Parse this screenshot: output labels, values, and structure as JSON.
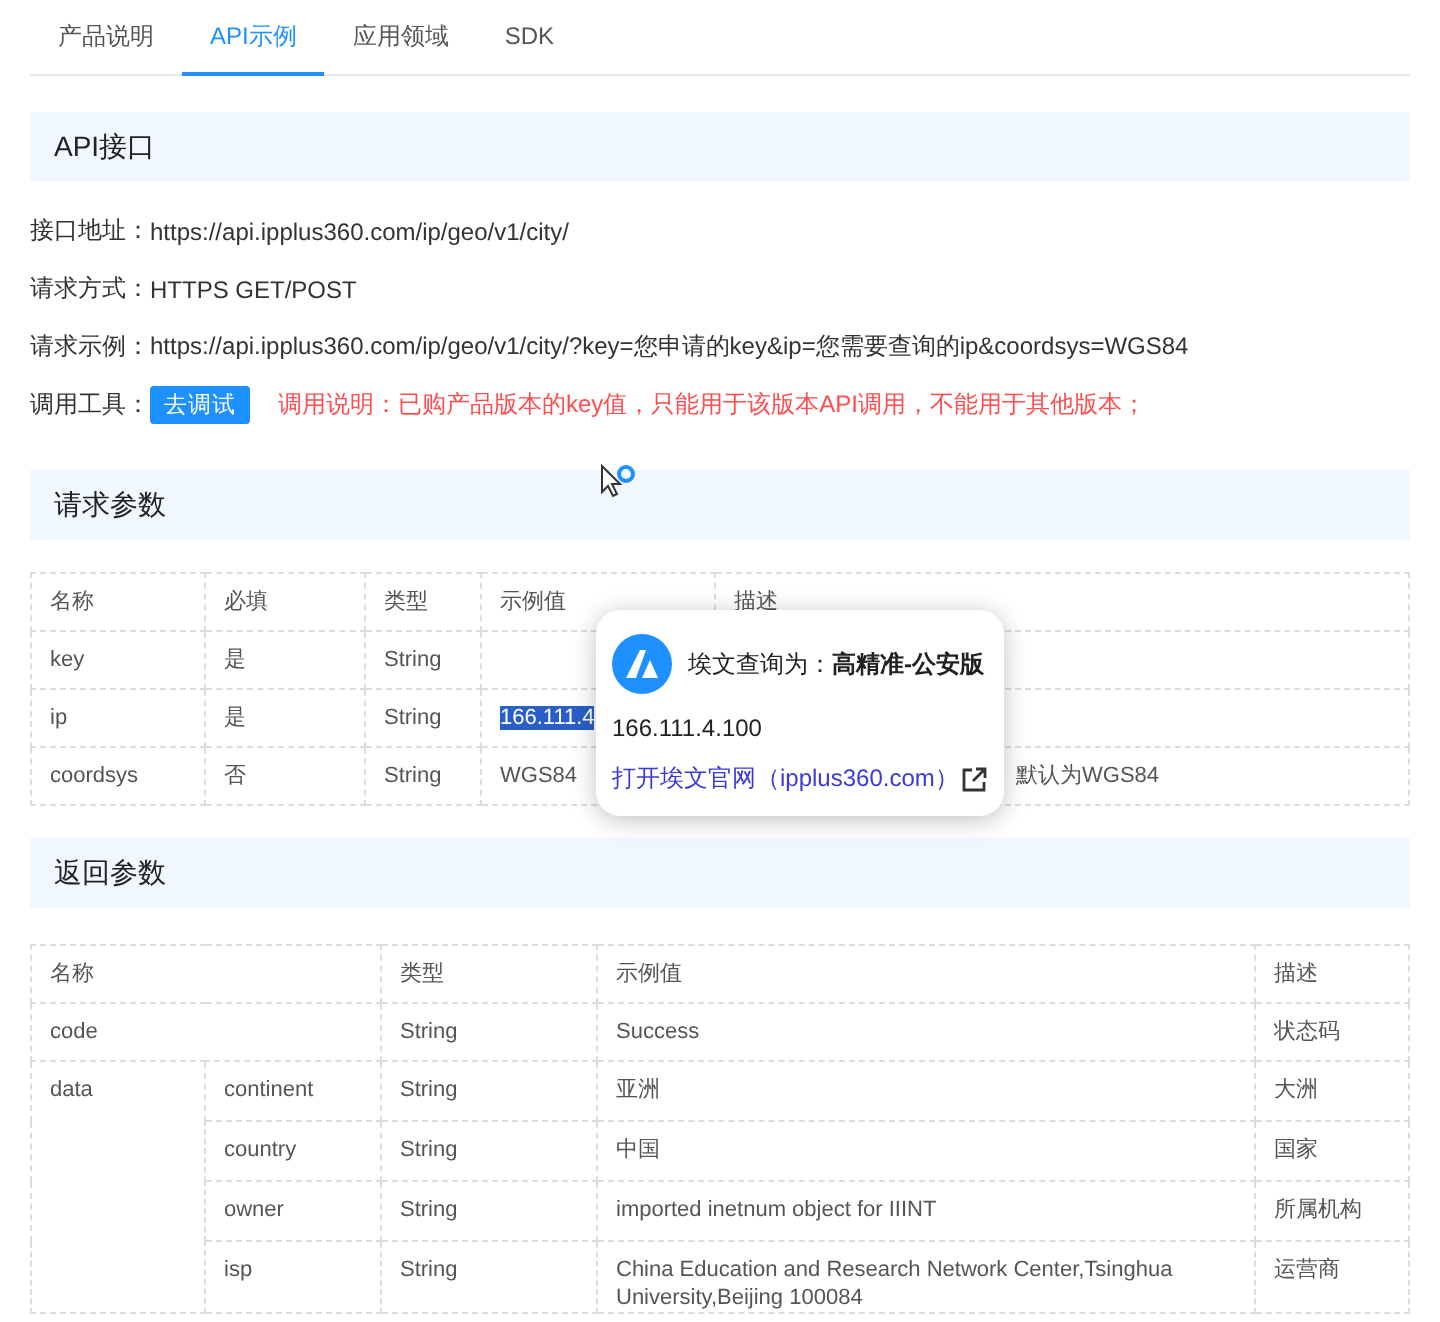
{
  "tabs": [
    {
      "label": "产品说明",
      "selected": false
    },
    {
      "label": "API示例",
      "selected": true
    },
    {
      "label": "应用领域",
      "selected": false
    },
    {
      "label": "SDK",
      "selected": false
    }
  ],
  "api_section": {
    "title": "API接口",
    "lines": [
      {
        "label": "接口地址：",
        "value": "https://api.ipplus360.com/ip/geo/v1/city/"
      },
      {
        "label": "请求方式：",
        "value": "HTTPS GET/POST"
      },
      {
        "label": "请求示例：",
        "value": "https://api.ipplus360.com/ip/geo/v1/city/?key=您申请的key&ip=您需要查询的ip&coordsys=WGS84"
      }
    ],
    "tool": {
      "label": "调用工具：",
      "button": "去调试",
      "note": "调用说明：已购产品版本的key值，只能用于该版本API调用，不能用于其他版本；"
    }
  },
  "request_section": {
    "title": "请求参数",
    "columns": [
      "名称",
      "必填",
      "类型",
      "示例值",
      "描述"
    ],
    "rows": [
      {
        "name": "key",
        "required": "是",
        "type": "String",
        "example_selected": false
      },
      {
        "name": "ip",
        "required": "是",
        "type": "String",
        "example": "166.111.4",
        "example_selected": true
      },
      {
        "name": "coordsys",
        "required": "否",
        "type": "String",
        "example": "WGS84",
        "description": "默认为WGS84",
        "example_selected": false
      }
    ]
  },
  "popup": {
    "title": "埃文查询为：**高精准-公安版**",
    "value": "166.111.4.100",
    "link": "打开埃文官网（ipplus360.com）"
  },
  "response_section": {
    "title": "返回参数",
    "columns": [
      "名称",
      "类型",
      "示例值",
      "描述"
    ],
    "rows": [
      {
        "name": "code",
        "type": "String",
        "example": "Success",
        "description": "状态码"
      },
      {
        "name": "data",
        "children": [
          {
            "name": "continent",
            "type": "String",
            "example": "亚洲",
            "description": "大洲"
          },
          {
            "name": "country",
            "type": "String",
            "example": "中国",
            "description": "国家"
          },
          {
            "name": "owner",
            "type": "String",
            "example": "imported inetnum object for IIINT",
            "description": "所属机构"
          },
          {
            "name": "isp",
            "type": "String",
            "example": "China Education and Research Network Center,Tsinghua University,Beijing 100084",
            "description": "运营商"
          }
        ]
      }
    ]
  }
}
